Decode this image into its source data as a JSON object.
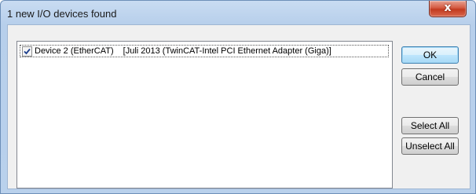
{
  "window": {
    "title": "1 new I/O devices found",
    "close_glyph": "x"
  },
  "device_list": {
    "items": [
      {
        "checked": true,
        "name": "Device 2 (EtherCAT)",
        "description": "[Juli 2013 (TwinCAT-Intel PCI Ethernet Adapter (Giga)]"
      }
    ]
  },
  "buttons": {
    "ok": "OK",
    "cancel": "Cancel",
    "select_all": "Select All",
    "unselect_all": "Unselect All"
  },
  "colors": {
    "title_bar": "#c9dcf2",
    "close_button": "#c23a1f",
    "dialog_background": "#f0f0f0",
    "default_button_border": "#3c7fb1"
  }
}
